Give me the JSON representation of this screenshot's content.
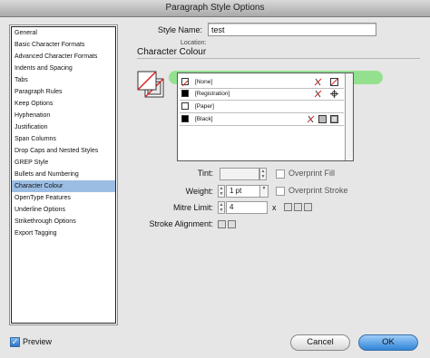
{
  "window": {
    "title": "Paragraph Style Options"
  },
  "sidebar": {
    "items": [
      {
        "label": "General"
      },
      {
        "label": "Basic Character Formats"
      },
      {
        "label": "Advanced Character Formats"
      },
      {
        "label": "Indents and Spacing"
      },
      {
        "label": "Tabs"
      },
      {
        "label": "Paragraph Rules"
      },
      {
        "label": "Keep Options"
      },
      {
        "label": "Hyphenation"
      },
      {
        "label": "Justification"
      },
      {
        "label": "Span Columns"
      },
      {
        "label": "Drop Caps and Nested Styles"
      },
      {
        "label": "GREP Style"
      },
      {
        "label": "Bullets and Numbering"
      },
      {
        "label": "Character Colour",
        "selected": true
      },
      {
        "label": "OpenType Features"
      },
      {
        "label": "Underline Options"
      },
      {
        "label": "Strikethrough Options"
      },
      {
        "label": "Export Tagging"
      }
    ]
  },
  "header": {
    "style_name_label": "Style Name:",
    "style_name_value": "test",
    "location_label": "Location:",
    "section_title": "Character Colour"
  },
  "swatches": [
    {
      "label": "[None]",
      "chip": "none",
      "selected": true
    },
    {
      "label": "[Registration]",
      "chip": "#000000"
    },
    {
      "label": "[Paper]",
      "chip": "#ffffff"
    },
    {
      "label": "[Black]",
      "chip": "#000000"
    }
  ],
  "controls": {
    "tint_label": "Tint:",
    "tint_value": "",
    "overprint_fill": "Overprint Fill",
    "weight_label": "Weight:",
    "weight_value": "1 pt",
    "overprint_stroke": "Overprint Stroke",
    "mitre_label": "Mitre Limit:",
    "mitre_value": "4",
    "mitre_x": "x",
    "stroke_alignment_label": "Stroke Alignment:"
  },
  "footer": {
    "preview_label": "Preview",
    "preview_checked": true,
    "cancel_label": "Cancel",
    "ok_label": "OK"
  },
  "colors": {
    "accent": "#2f84d8",
    "selection": "#9bbde3",
    "highlight": "#8ee08a"
  }
}
